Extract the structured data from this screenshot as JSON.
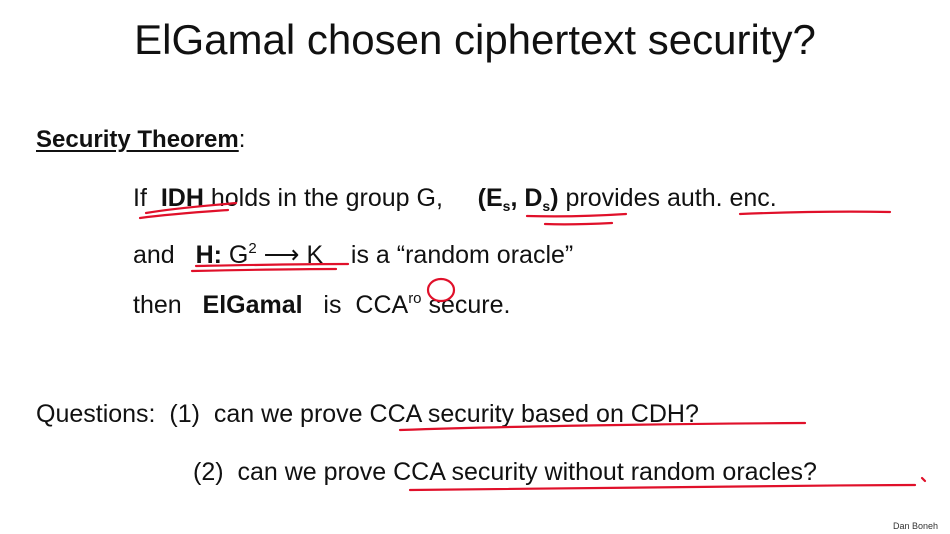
{
  "slide": {
    "title": "ElGamal chosen ciphertext security?",
    "theorem_heading": "Security Theorem",
    "theorem_colon": ":",
    "line1": {
      "if": "If",
      "idh": "IDH",
      "rest1": "holds in the group G,",
      "es_open": "(E",
      "es_sub": "s",
      "comma": ", D",
      "ds_sub": "s",
      "close": ")",
      "provides": "provides",
      "auth": "auth. enc."
    },
    "line2": {
      "and": "and",
      "h": "H:",
      "g": "G",
      "g_sup": "2",
      "arrow": "⟶ K",
      "rest": "is a   “random oracle”"
    },
    "line3": {
      "then": "then",
      "elgamal": "ElGamal",
      "is": "is",
      "cca": "CCA",
      "cca_sup": "ro",
      "secure": "secure."
    },
    "questions": {
      "label": "Questions:",
      "q1_num": "(1)",
      "q1_pre": "can we prove",
      "q1_rest": "CCA security based on CDH?",
      "q2_num": "(2)",
      "q2_pre": "can we prove",
      "q2_rest": "CCA security without random oracles?"
    },
    "author": "Dan Boneh"
  },
  "colors": {
    "ink": "#e0102a",
    "text": "#111111"
  }
}
